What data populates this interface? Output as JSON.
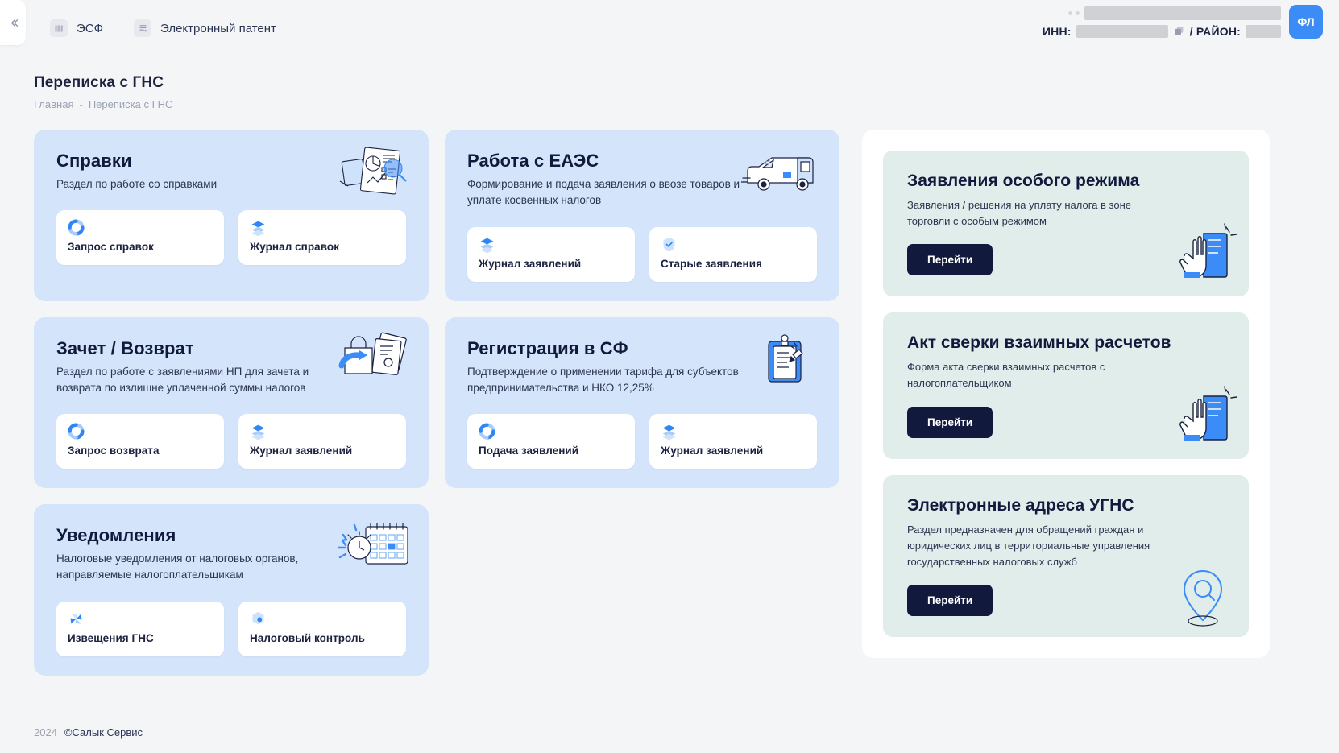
{
  "topbar": {
    "collapse_icon": "chevron-double-left-icon",
    "nav_items": [
      {
        "label": "ЭСФ",
        "icon": "barcode-icon"
      },
      {
        "label": "Электронный патент",
        "icon": "document-lines-icon"
      }
    ],
    "user": {
      "name_value": "",
      "inn_label": "ИНН:",
      "inn_value": "",
      "copy_icon": "copy-icon",
      "raion_label": "/ РАЙОН:",
      "raion_value": "",
      "badge_label": "ФЛ"
    }
  },
  "header": {
    "title": "Переписка с ГНС",
    "breadcrumb": [
      "Главная",
      "Переписка с ГНС"
    ],
    "breadcrumb_separator": "-"
  },
  "main_cards": [
    {
      "title": "Справки",
      "subtitle": "Раздел по работе со справками",
      "illustration": "report-magnifier-icon",
      "tiles": [
        {
          "label": "Запрос справок",
          "icon": "sync-ring-icon"
        },
        {
          "label": "Журнал справок",
          "icon": "layers-icon"
        }
      ]
    },
    {
      "title": "Работа с ЕАЭС",
      "subtitle": "Формирование и подача заявления о ввозе товаров и уплате косвенных налогов",
      "illustration": "delivery-van-icon",
      "tiles": [
        {
          "label": "Журнал заявлений",
          "icon": "layers-icon"
        },
        {
          "label": "Старые заявления",
          "icon": "shield-check-icon"
        }
      ]
    },
    {
      "title": "Зачет / Возврат",
      "subtitle": "Раздел по работе с заявлениями НП для зачета и возврата по излишне уплаченной суммы налогов",
      "illustration": "shopping-bag-return-icon",
      "tiles": [
        {
          "label": "Запрос возврата",
          "icon": "sync-ring-icon"
        },
        {
          "label": "Журнал заявлений",
          "icon": "layers-icon"
        }
      ]
    },
    {
      "title": "Регистрация в СФ",
      "subtitle": "Подтверждение о применении тарифа для субъектов предпринимательства и НКО 12,25%",
      "illustration": "clipboard-pen-icon",
      "tiles": [
        {
          "label": "Подача заявлений",
          "icon": "sync-ring-icon"
        },
        {
          "label": "Журнал заявлений",
          "icon": "layers-icon"
        }
      ]
    },
    {
      "title": "Уведомления",
      "subtitle": "Налоговые уведомления от налоговых органов, направляемые налогоплательщикам",
      "illustration": "alarm-calendar-icon",
      "tiles": [
        {
          "label": "Извещения ГНС",
          "icon": "sparkle-star-icon"
        },
        {
          "label": "Налоговый контроль",
          "icon": "hexagon-dot-icon"
        }
      ]
    }
  ],
  "side_cards": [
    {
      "title": "Заявления особого режима",
      "subtitle": "Заявления / решения на уплату налога в зоне торговли с особым режимом",
      "button_label": "Перейти",
      "illustration": "hand-book-icon"
    },
    {
      "title": "Акт сверки взаимных расчетов",
      "subtitle": "Форма акта сверки взаимных расчетов с налогоплательщиком",
      "button_label": "Перейти",
      "illustration": "hand-book-icon"
    },
    {
      "title": "Электронные адреса УГНС",
      "subtitle": "Раздел предназначен для обращений граждан и юридических лиц в территориальные управления государственных налоговых служб",
      "button_label": "Перейти",
      "illustration": "map-pin-search-icon"
    }
  ],
  "footer": {
    "year": "2024",
    "brand": "©Салык Сервис"
  },
  "colors": {
    "page_bg": "#f4f5f7",
    "blue_card": "#d4e4fb",
    "mint_card": "#e0edea",
    "accent_blue": "#3b8cf7",
    "dark_navy": "#111a3d"
  }
}
